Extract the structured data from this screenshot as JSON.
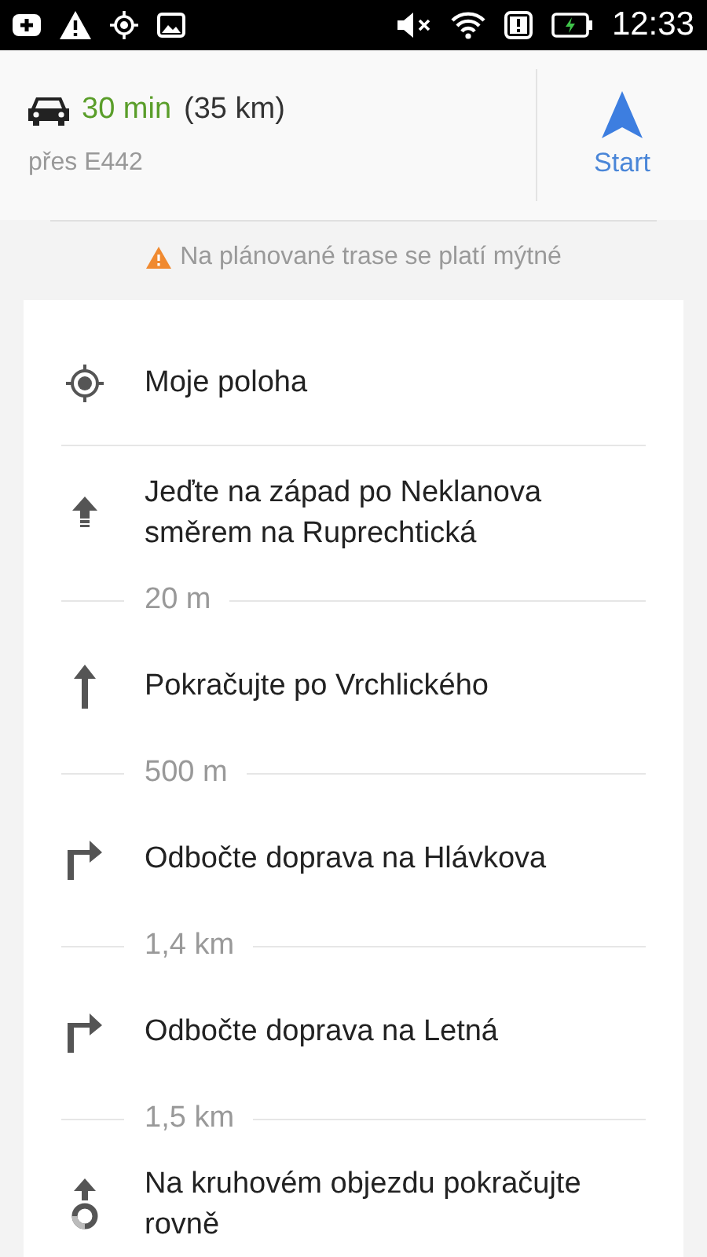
{
  "status_bar": {
    "time": "12:33"
  },
  "route": {
    "duration": "30 min",
    "distance": "(35 km)",
    "via": "přes E442",
    "start_label": "Start"
  },
  "notice": {
    "text": "Na plánované trase se platí mýtné"
  },
  "steps": [
    {
      "kind": "location",
      "text": "Moje poloha"
    },
    {
      "kind": "depart",
      "text": "Jeďte na západ po Neklanova směrem na Ruprechtická",
      "distance": "20 m"
    },
    {
      "kind": "straight",
      "text": "Pokračujte po Vrchlického",
      "distance": "500 m"
    },
    {
      "kind": "turn-right",
      "text": "Odbočte doprava na Hlávkova",
      "distance": "1,4 km"
    },
    {
      "kind": "turn-right",
      "text": "Odbočte doprava na Letná",
      "distance": "1,5 km"
    },
    {
      "kind": "roundabout",
      "text": "Na kruhovém objezdu pokračujte rovně"
    }
  ]
}
